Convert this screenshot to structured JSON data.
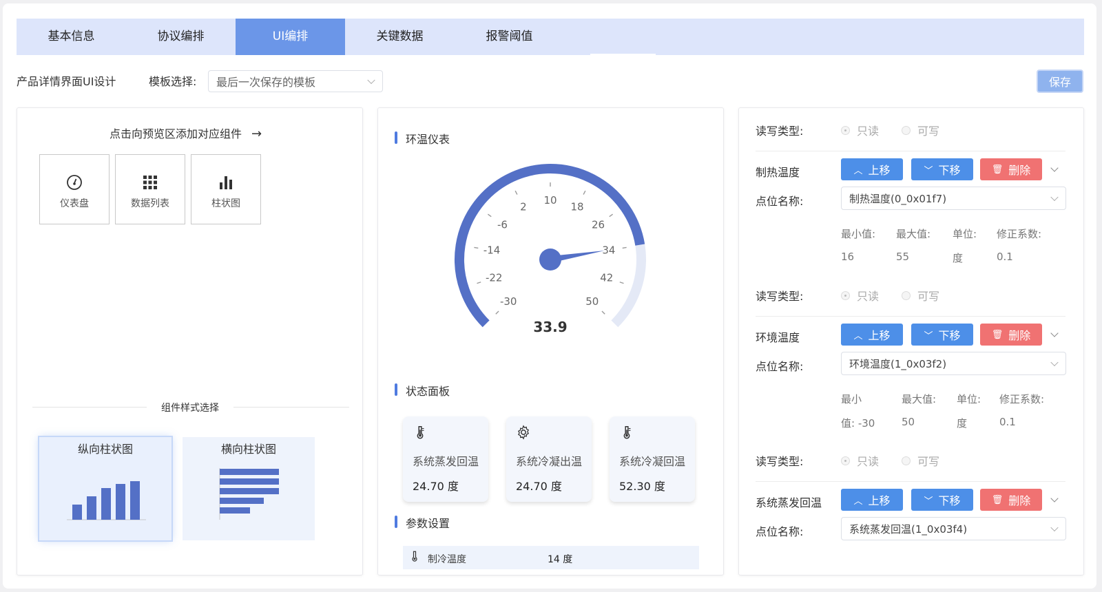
{
  "tabs": [
    "基本信息",
    "协议编排",
    "UI编排",
    "关键数据",
    "报警阈值"
  ],
  "topbar": {
    "title": "产品详情界面UI设计",
    "template_label": "模板选择:",
    "template_value": "最后一次保存的模板",
    "save_label": "保存"
  },
  "left": {
    "add_hint": "点击向预览区添加对应组件",
    "components": [
      {
        "label": "仪表盘",
        "icon": "gauge-icon"
      },
      {
        "label": "数据列表",
        "icon": "grid-icon"
      },
      {
        "label": "柱状图",
        "icon": "bar-chart-icon"
      }
    ],
    "style_section": "组件样式选择",
    "styles": [
      "纵向柱状图",
      "横向柱状图"
    ]
  },
  "middle": {
    "gauge_title": "环温仪表",
    "gauge": {
      "min": -30,
      "max": 50,
      "value": 33.9,
      "value_label": "33.9",
      "ticks": [
        "-30",
        "-22",
        "-14",
        "-6",
        "2",
        "10",
        "18",
        "26",
        "34",
        "42",
        "50"
      ]
    },
    "status_title": "状态面板",
    "status_cards": [
      {
        "name": "系统蒸发回温",
        "value": "24.70 度",
        "icon": "thermometer-icon"
      },
      {
        "name": "系统冷凝出温",
        "value": "24.70 度",
        "icon": "gear-icon"
      },
      {
        "name": "系统冷凝回温",
        "value": "52.30 度",
        "icon": "thermometer-icon"
      }
    ],
    "param_title": "参数设置",
    "param_row": {
      "name": "制冷温度",
      "value": "14 度"
    }
  },
  "right": {
    "rw_label": "读写类型:",
    "radio_readonly": "只读",
    "radio_writable": "可写",
    "point_label": "点位名称:",
    "btn_up": "上移",
    "btn_down": "下移",
    "btn_delete": "删除",
    "items": [
      {
        "name": "制热温度",
        "point": "制热温度(0_0x01f7)",
        "min_label": "最小值:",
        "min": "16",
        "max_label": "最大值:",
        "max": "55",
        "unit_label": "单位:",
        "unit": "度",
        "coef_label": "修正系数:",
        "coef": "0.1"
      },
      {
        "name": "环境温度",
        "point": "环境温度(1_0x03f2)",
        "min_label": "最小",
        "min": "值: -30",
        "max_label": "最大值:",
        "max": "50",
        "unit_label": "单位:",
        "unit": "度",
        "coef_label": "修正系数:",
        "coef": "0.1"
      },
      {
        "name": "系统蒸发回温",
        "point": "系统蒸发回温(1_0x03f4)"
      }
    ]
  },
  "colors": {
    "accent": "#4d8fe8",
    "tab_active": "#6b96e8",
    "gauge": "#5470c6",
    "danger": "#f07272"
  }
}
